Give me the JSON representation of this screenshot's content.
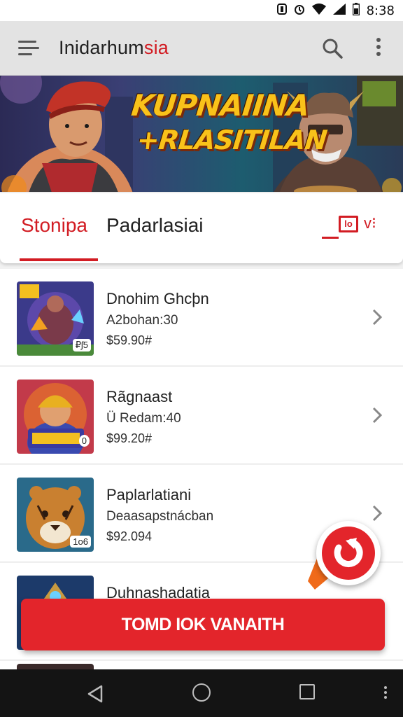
{
  "status_bar": {
    "time": "8:38",
    "icons": [
      "notification-icon",
      "alarm-icon",
      "wifi-icon",
      "signal-icon",
      "battery-icon"
    ]
  },
  "app_bar": {
    "title_main": "Inidarhum",
    "title_accent": "sia",
    "accent_color": "#d21c23"
  },
  "banner": {
    "line1": "KUPNAIINA",
    "line2": "+RLASITILAN"
  },
  "tabs": {
    "active": "Stonipa",
    "second": "Padarlasiai",
    "toggle_label": "lo"
  },
  "list": [
    {
      "title": "Dnohim Ghcþn",
      "subtitle": "A2bohan:30",
      "price": "$59.90#",
      "badge": "₽ʃ5"
    },
    {
      "title": "Rãgnaast",
      "subtitle": "Ü Redam:40",
      "price": "$99.20#",
      "badge": "0"
    },
    {
      "title": "Paplarlatiani",
      "subtitle": "Deaasapstnácban",
      "price": "$92.094",
      "badge": "1o6"
    },
    {
      "title": "Duhnashadatia",
      "subtitle": "",
      "price": "",
      "badge": ""
    }
  ],
  "cta": {
    "label": "TOMD IOK VANAITH"
  },
  "colors": {
    "brand_red": "#e3252b",
    "appbar_bg": "#e3e3e3",
    "nav_bg": "#141414"
  }
}
